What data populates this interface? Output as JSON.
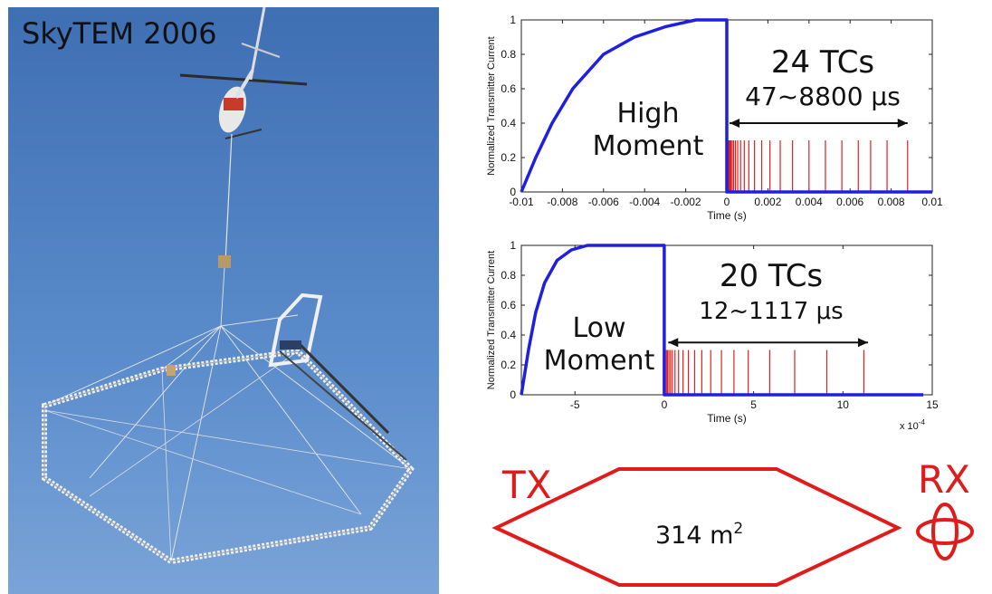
{
  "photo": {
    "title": "SkyTEM 2006",
    "sky_color": "#5a88c6"
  },
  "chart_data": [
    {
      "type": "line",
      "xlabel": "Time (s)",
      "ylabel": "Normalized Transmitter Current",
      "xlim": [
        -0.01,
        0.01
      ],
      "ylim": [
        0,
        1
      ],
      "xticks": [
        -0.01,
        -0.008,
        -0.006,
        -0.004,
        -0.002,
        0,
        0.002,
        0.004,
        0.006,
        0.008,
        0.01
      ],
      "xtick_labels": [
        "-0.01",
        "-0.008",
        "-0.006",
        "-0.004",
        "-0.002",
        "0",
        "0.002",
        "0.004",
        "0.006",
        "0.008",
        "0.01"
      ],
      "yticks": [
        0,
        0.2,
        0.4,
        0.6,
        0.8,
        1
      ],
      "ytick_labels": [
        "0",
        "0.2",
        "0.4",
        "0.6",
        "0.8",
        "1"
      ],
      "series": [
        {
          "color": "#1f1fe0",
          "x": [
            -0.01,
            -0.0093,
            -0.0085,
            -0.0075,
            -0.006,
            -0.0045,
            -0.003,
            -0.0015,
            -0.0002,
            0,
            0,
            0.01
          ],
          "y": [
            0,
            0.2,
            0.4,
            0.6,
            0.8,
            0.9,
            0.96,
            1.0,
            1.0,
            1.0,
            0,
            0
          ]
        }
      ],
      "gate_times": [
        5e-05,
        8e-05,
        0.00011,
        0.00015,
        0.0002,
        0.00026,
        0.00033,
        0.00042,
        0.00053,
        0.00067,
        0.00085,
        0.00107,
        0.00135,
        0.0017,
        0.0021,
        0.0026,
        0.0032,
        0.004,
        0.0048,
        0.0056,
        0.0064,
        0.007,
        0.0078,
        0.0088
      ],
      "gate_color": "#e02020",
      "gate_height": 0.3,
      "annotation": {
        "title": "24 TCs",
        "range": "47~8800 μs",
        "moment_line1": "High",
        "moment_line2": "Moment",
        "arrow_from": 5e-05,
        "arrow_to": 0.0088
      }
    },
    {
      "type": "line",
      "xlabel": "Time (s)",
      "ylabel": "Normalized Transmitter Current",
      "xlim": [
        -8,
        15
      ],
      "ylim": [
        0,
        1
      ],
      "x_multiplier": "x 10",
      "x_multiplier_exp": "-4",
      "xticks": [
        -5,
        0,
        5,
        10,
        15
      ],
      "xtick_labels": [
        "-5",
        "0",
        "5",
        "10",
        "15"
      ],
      "yticks": [
        0,
        0.2,
        0.4,
        0.6,
        0.8,
        1
      ],
      "ytick_labels": [
        "0",
        "0.2",
        "0.4",
        "0.6",
        "0.8",
        "1"
      ],
      "series": [
        {
          "color": "#1f1fe0",
          "x": [
            -8,
            -7.6,
            -7.2,
            -6.7,
            -6.0,
            -5.2,
            -4.3,
            -3.5,
            0,
            0,
            14.5
          ],
          "y": [
            0,
            0.3,
            0.55,
            0.75,
            0.9,
            0.97,
            1.0,
            1.0,
            1.0,
            0,
            0
          ]
        }
      ],
      "gate_times": [
        0.12,
        0.18,
        0.26,
        0.35,
        0.45,
        0.6,
        0.8,
        1.05,
        1.35,
        1.7,
        2.1,
        2.6,
        3.2,
        3.9,
        4.7,
        5.9,
        7.3,
        9.1,
        11.17
      ],
      "gate_color": "#e02020",
      "gate_height": 0.3,
      "annotation": {
        "title": "20 TCs",
        "range": "12~1117 μs",
        "moment_line1": "Low",
        "moment_line2": "Moment",
        "arrow_from": 0.12,
        "arrow_to": 11.4
      }
    }
  ],
  "loop": {
    "tx_label": "TX",
    "rx_label": "RX",
    "area_text": "314 m",
    "area_sup": "2",
    "color": "#e01b1b"
  }
}
